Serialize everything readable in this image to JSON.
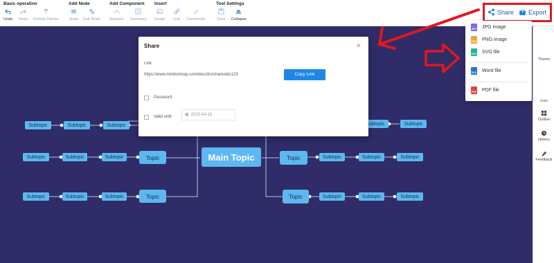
{
  "toolbar": {
    "groups": {
      "basic": "Basic operation",
      "add_node": "Add Node",
      "add_component": "Add Component",
      "insert": "Insert",
      "tool_settings": "Tool Settings"
    },
    "buttons": {
      "undo": "Undo",
      "redo": "Redo",
      "format_painter": "Format Painter",
      "node": "Node",
      "sub_node": "Sub Node",
      "relation": "Relation",
      "summary": "Summary",
      "image": "Image",
      "link": "Link",
      "comments": "Comments",
      "save": "Save",
      "collapse": "Collapse"
    }
  },
  "topbar": {
    "share": "Share",
    "export": "Export"
  },
  "export_menu": {
    "items": [
      "JPG image",
      "PNG image",
      "SVG file",
      "Word file",
      "PDF file"
    ],
    "icon_labels": [
      "JPG",
      "PNG",
      "SVG",
      "DOC",
      "PDF"
    ],
    "colors": [
      "#7e6bdb",
      "#f0a23a",
      "#27b39a",
      "#2f6fd6",
      "#e0423a"
    ]
  },
  "share_modal": {
    "title": "Share",
    "link_label": "Link",
    "link_value": "https://www.mindonmap.com/doc/d/s/share/abc123",
    "copy_button": "Copy Link",
    "password_option": "Password",
    "valid_option": "Valid until",
    "date_placeholder": "2023-04-10"
  },
  "right_panel": {
    "items": [
      "Theme",
      "Icon",
      "Outline",
      "History",
      "Feedback"
    ]
  },
  "mindmap": {
    "main_topic": "Main Topic",
    "topic_label": "Topic",
    "subtopic_label": "Subtopic"
  },
  "colors": {
    "canvas": "#2f2c68",
    "node": "#5bb8f0",
    "accent": "#1e88e5",
    "highlight": "#e0181f"
  }
}
